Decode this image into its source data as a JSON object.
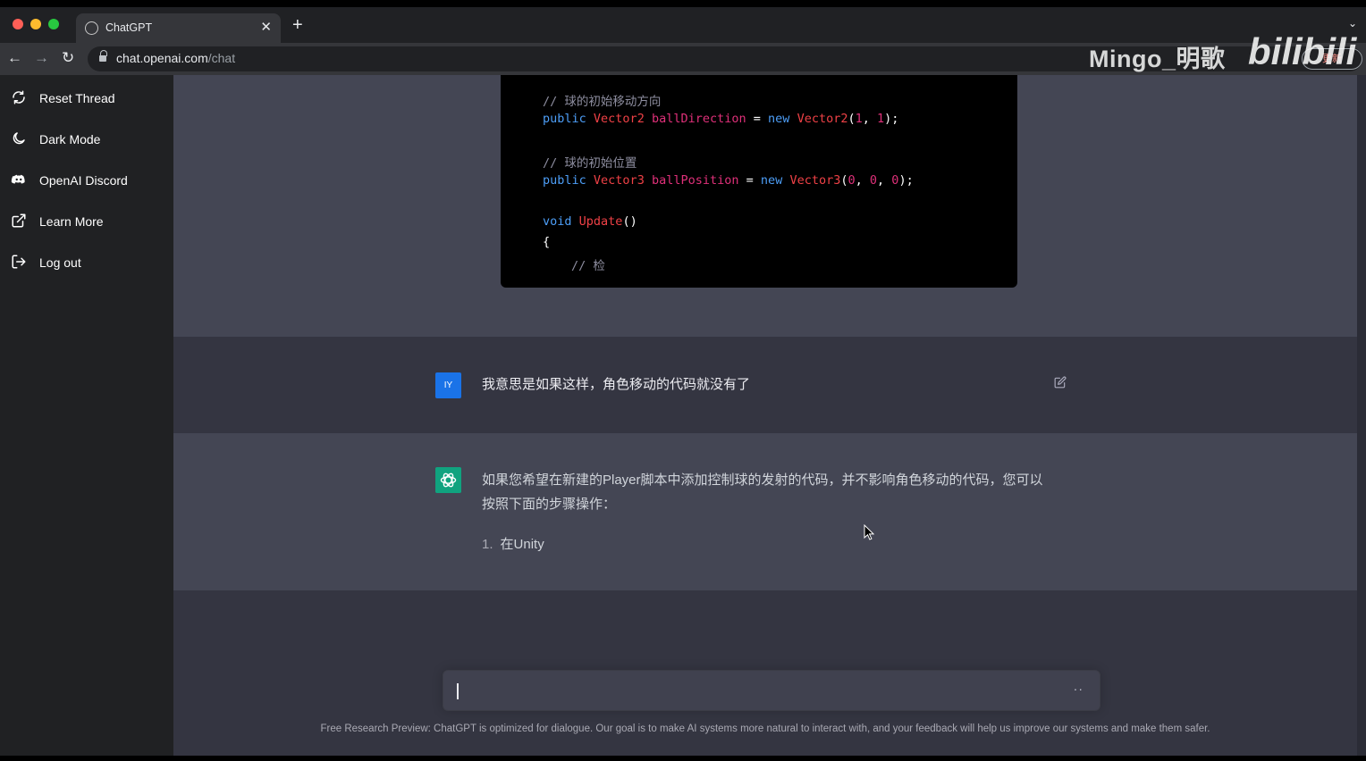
{
  "browser": {
    "tab_title": "ChatGPT",
    "tab_close": "✕",
    "new_tab": "+",
    "tab_menu": "⌄",
    "url_host": "chat.openai.com",
    "url_path": "/chat",
    "profile_label": "更新",
    "toolbar_icons": "⊕ ☆ ★ ▢ ⬡"
  },
  "watermark": {
    "text": "Mingo_明歌",
    "logo": "bilibili"
  },
  "sidebar": {
    "items": [
      {
        "label": "Reset Thread",
        "icon": "refresh-icon"
      },
      {
        "label": "Dark Mode",
        "icon": "moon-icon"
      },
      {
        "label": "OpenAI Discord",
        "icon": "discord-icon"
      },
      {
        "label": "Learn More",
        "icon": "external-link-icon"
      },
      {
        "label": "Log out",
        "icon": "logout-icon"
      }
    ]
  },
  "code": {
    "comment1": "// 球的初始移动方向",
    "line2_kw": "public",
    "line2_type": "Vector2",
    "line2_var": "ballDirection",
    "line2_eq": " = ",
    "line2_new": "new",
    "line2_ctor": "Vector2",
    "line2_args_open": "(",
    "line2_a1": "1",
    "line2_sep": ", ",
    "line2_a2": "1",
    "line2_close": ");",
    "comment2": "// 球的初始位置",
    "line4_kw": "public",
    "line4_type": "Vector3",
    "line4_var": "ballPosition",
    "line4_eq": " = ",
    "line4_new": "new",
    "line4_ctor": "Vector3",
    "line4_open": "(",
    "line4_a1": "0",
    "line4_a2": "0",
    "line4_a3": "0",
    "line4_close": ");",
    "line6_kw": "void",
    "line6_fn": "Update",
    "line6_parens": "()",
    "line7": "{",
    "line8": "// 检"
  },
  "conversation": {
    "user_avatar": "IY",
    "user_message": "我意思是如果这样，角色移动的代码就没有了",
    "bot_message": "如果您希望在新建的Player脚本中添加控制球的发射的代码，并不影响角色移动的代码，您可以按照下面的步骤操作：",
    "bot_list_number": "1.",
    "bot_list_text": "在Unity"
  },
  "input": {
    "value": "",
    "send_indicator": "··"
  },
  "footer": "Free Research Preview: ChatGPT is optimized for dialogue. Our goal is to make AI systems more natural to interact with, and your feedback will help us improve our systems and make them safer.",
  "colors": {
    "sidebar_bg": "#202123",
    "main_bg": "#343541",
    "bot_bg": "#444654",
    "accent_green": "#10a37f",
    "user_avatar": "#1a73e8"
  }
}
